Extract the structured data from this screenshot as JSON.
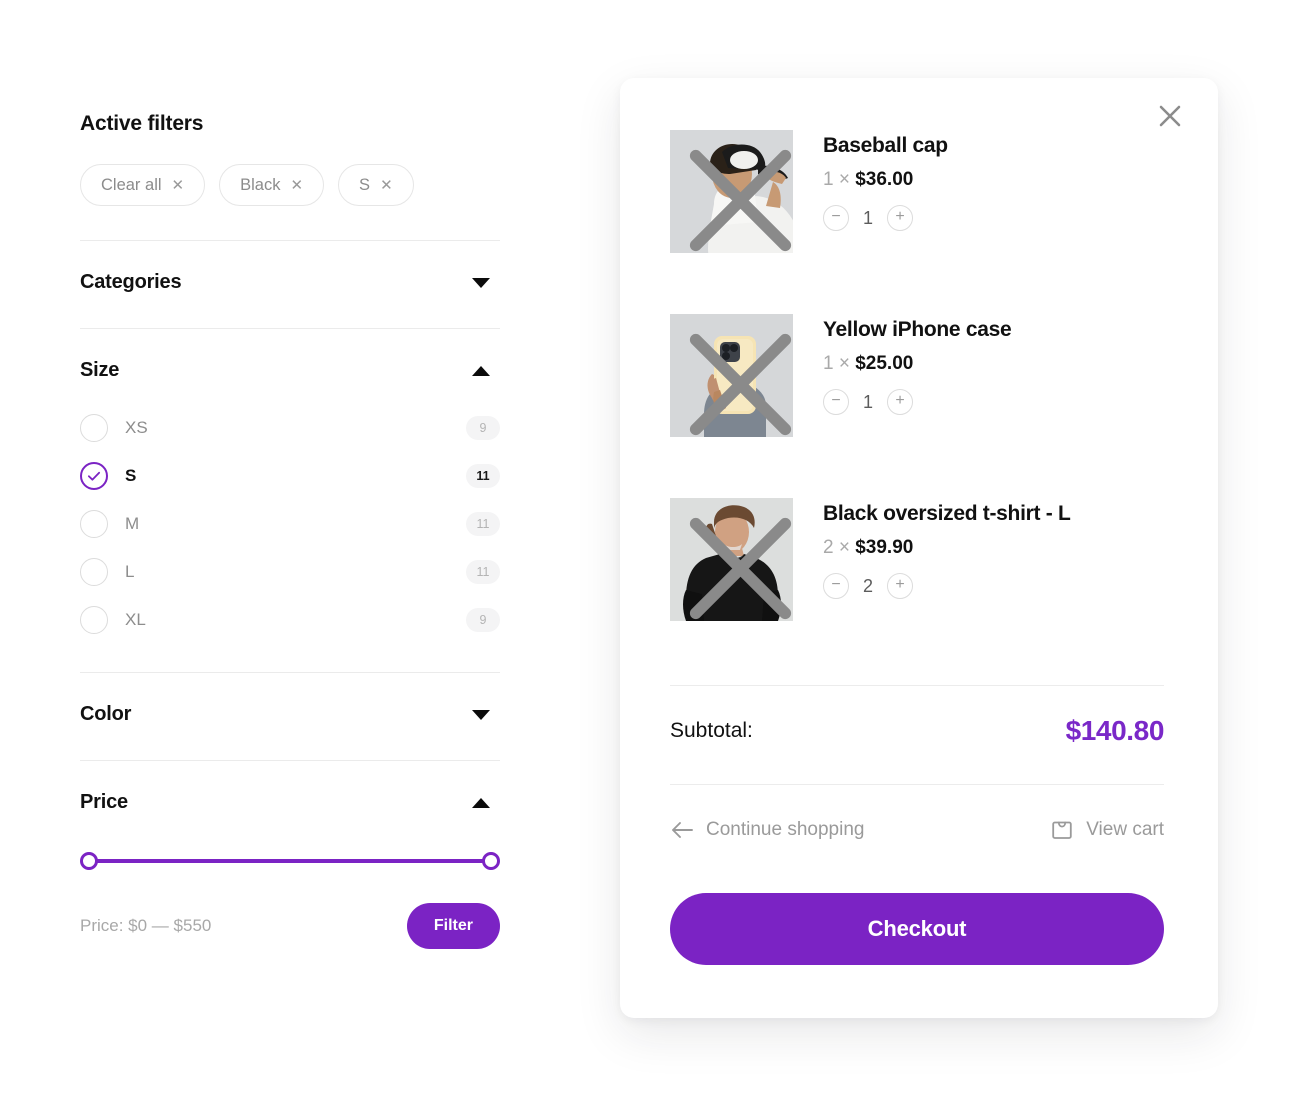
{
  "filters": {
    "title": "Active filters",
    "chips": [
      {
        "label": "Clear all",
        "remove_icon": "close-icon"
      },
      {
        "label": "Black",
        "remove_icon": "close-icon"
      },
      {
        "label": "S",
        "remove_icon": "close-icon"
      }
    ],
    "sections": [
      {
        "title": "Categories",
        "expanded": false,
        "caret_icon": "chevron-down-icon"
      },
      {
        "title": "Size",
        "expanded": true,
        "caret_icon": "chevron-up-icon"
      },
      {
        "title": "Color",
        "expanded": false,
        "caret_icon": "chevron-down-icon"
      },
      {
        "title": "Price",
        "expanded": true,
        "caret_icon": "chevron-up-icon"
      }
    ],
    "size_options": [
      {
        "label": "XS",
        "count": "9",
        "selected": false
      },
      {
        "label": "S",
        "count": "11",
        "selected": true
      },
      {
        "label": "M",
        "count": "11",
        "selected": false
      },
      {
        "label": "L",
        "count": "11",
        "selected": false
      },
      {
        "label": "XL",
        "count": "9",
        "selected": false
      }
    ],
    "price": {
      "range_label": "Price: $0 — $550",
      "min": "$0",
      "max": "$550",
      "filter_button": "Filter",
      "slider_min_pct": 0,
      "slider_max_pct": 100
    },
    "accent_color": "#7b23c4"
  },
  "cart": {
    "close_icon": "close-icon",
    "items": [
      {
        "title": "Baseball cap",
        "price_qty": "1",
        "price": "$36.00",
        "multiply": "×",
        "quantity": "1",
        "remove_icon": "close-icon",
        "decrement_label": "−",
        "increment_label": "+",
        "thumbnail": "man-in-white-tee-wearing-black-and-white-baseball-cap"
      },
      {
        "title": "Yellow iPhone case",
        "price_qty": "1",
        "price": "$25.00",
        "multiply": "×",
        "quantity": "1",
        "remove_icon": "close-icon",
        "decrement_label": "−",
        "increment_label": "+",
        "thumbnail": "hand-holding-cream-yellow-iphone-case"
      },
      {
        "title": "Black oversized t-shirt - L",
        "price_qty": "2",
        "price": "$39.90",
        "multiply": "×",
        "quantity": "2",
        "remove_icon": "close-icon",
        "decrement_label": "−",
        "increment_label": "+",
        "thumbnail": "man-wearing-black-oversized-t-shirt"
      }
    ],
    "subtotal_label": "Subtotal:",
    "subtotal_value": "$140.80",
    "subtotal_color": "#7a28c8",
    "continue_shopping": "Continue shopping",
    "continue_icon": "arrow-left-icon",
    "view_cart": "View cart",
    "view_cart_icon": "shopping-bag-icon",
    "checkout_label": "Checkout",
    "checkout_color": "#7b23c4"
  }
}
